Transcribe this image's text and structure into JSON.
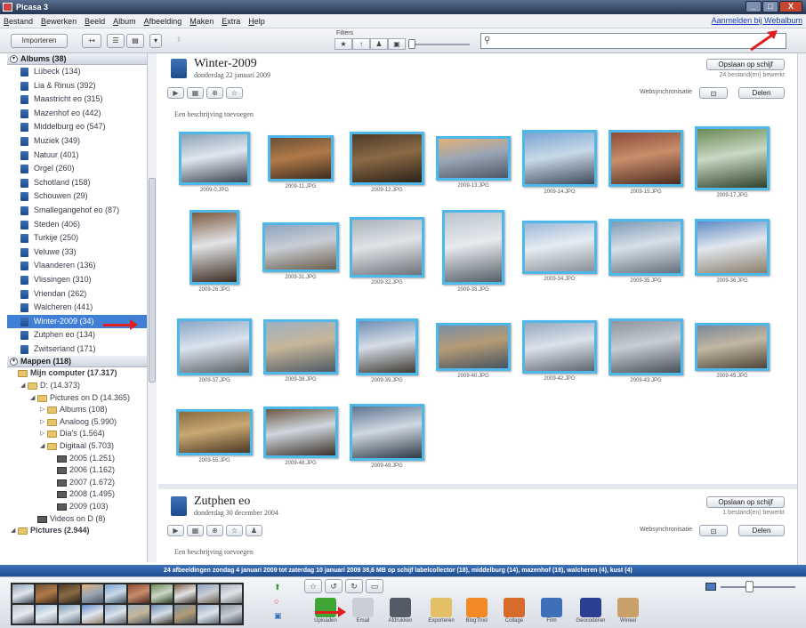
{
  "window": {
    "title": "Picasa 3",
    "min": "_",
    "max": "□",
    "close": "X"
  },
  "menu": {
    "items": [
      "Bestand",
      "Bewerken",
      "Beeld",
      "Album",
      "Afbeelding",
      "Maken",
      "Extra",
      "Help"
    ],
    "login": "Aanmelden bij Webalbum"
  },
  "toolbar": {
    "import": "Importeren",
    "filters_label": "Filters",
    "filter_icons": [
      "★",
      "↑",
      "♟",
      "▣"
    ],
    "search_placeholder": ""
  },
  "sidebar": {
    "albums_header": "Albums (38)",
    "albums": [
      "Lübeck (134)",
      "Lia & Rinus (392)",
      "Maastricht eo (315)",
      "Mazenhof eo (442)",
      "Middelburg eo (547)",
      "Muziek (349)",
      "Natuur (401)",
      "Orgel (260)",
      "Schotland (158)",
      "Schouwen (29)",
      "Smallegangehof eo (87)",
      "Steden (406)",
      "Turkije (250)",
      "Veluwe (33)",
      "Vlaanderen (136)",
      "Vlissingen (310)",
      "Vriendan (262)",
      "Walcheren (441)",
      "Winter-2009 (34)",
      "Zutphen eo (134)",
      "Zwitserland (171)"
    ],
    "selected_album": "Winter-2009 (34)",
    "folders_header": "Mappen (118)",
    "folders": [
      {
        "label": "Mijn computer (17.317)",
        "level": 0,
        "type": "folder",
        "arrow": ""
      },
      {
        "label": "D: (14.373)",
        "level": 1,
        "type": "folder",
        "arrow": "◢"
      },
      {
        "label": "Pictures on D (14.365)",
        "level": 2,
        "type": "folder",
        "arrow": "◢"
      },
      {
        "label": "Albums (108)",
        "level": 3,
        "type": "folder",
        "arrow": "▷"
      },
      {
        "label": "Analoog (5.990)",
        "level": 3,
        "type": "folder",
        "arrow": "▷"
      },
      {
        "label": "Dia's (1.564)",
        "level": 3,
        "type": "folder",
        "arrow": "▷"
      },
      {
        "label": "Digitaal (5.703)",
        "level": 3,
        "type": "folder",
        "arrow": "◢"
      },
      {
        "label": "2005 (1.251)",
        "level": 4,
        "type": "year",
        "arrow": ""
      },
      {
        "label": "2006 (1.162)",
        "level": 4,
        "type": "year",
        "arrow": ""
      },
      {
        "label": "2007 (1.672)",
        "level": 4,
        "type": "year",
        "arrow": ""
      },
      {
        "label": "2008 (1.495)",
        "level": 4,
        "type": "year",
        "arrow": ""
      },
      {
        "label": "2009 (103)",
        "level": 4,
        "type": "year",
        "arrow": ""
      },
      {
        "label": "Videos on D (8)",
        "level": 2,
        "type": "year",
        "arrow": ""
      },
      {
        "label": "Pictures (2.944)",
        "level": 0,
        "type": "folder",
        "arrow": "◢"
      }
    ]
  },
  "album1": {
    "name": "Winter-2009",
    "date": "donderdag 22 januari 2009",
    "save": "Opslaan op schijf",
    "count": "24 bestand(en) bewerkt",
    "buttons": [
      "▶",
      "▦",
      "⊕",
      "☆"
    ],
    "sync_label": "Websynchronisatie",
    "delete": "Delen",
    "desc": "Een beschrijving toevoegen",
    "photos": [
      {
        "cap": "2009-0.JPG",
        "colors": [
          "#8ea3b6",
          "#dfe6ee",
          "#3b4552"
        ]
      },
      {
        "cap": "2009-11.JPG",
        "colors": [
          "#6b5036",
          "#b07a48",
          "#3e2c1f"
        ]
      },
      {
        "cap": "2009-12.JPG",
        "colors": [
          "#4a3a28",
          "#8b6a45",
          "#2a2219"
        ]
      },
      {
        "cap": "2009-13.JPG",
        "colors": [
          "#e2b07a",
          "#9aa6b5",
          "#4d5866"
        ]
      },
      {
        "cap": "2009-14.JPG",
        "colors": [
          "#7aa4d1",
          "#c8d9e8",
          "#3d4a5a"
        ]
      },
      {
        "cap": "2009-15.JPG",
        "colors": [
          "#8a4b35",
          "#c98e6b",
          "#4c2a1f"
        ]
      },
      {
        "cap": "2009-17.JPG",
        "colors": [
          "#6a8a55",
          "#c9d8c4",
          "#2f3f28"
        ]
      },
      {
        "cap": "2009-26.JPG",
        "colors": [
          "#7d5a40",
          "#e2e4e6",
          "#3d2d22"
        ]
      },
      {
        "cap": "2009-31.JPG",
        "colors": [
          "#8ea4be",
          "#c9ced5",
          "#6b5d4c"
        ]
      },
      {
        "cap": "2009-32.JPG",
        "colors": [
          "#aab3bc",
          "#dfe3e7",
          "#6d737a"
        ]
      },
      {
        "cap": "2009-33.JPG",
        "colors": [
          "#b9c3cc",
          "#e7eaee",
          "#555e68"
        ]
      },
      {
        "cap": "2009-34.JPG",
        "colors": [
          "#9db7d4",
          "#e5ecf2",
          "#8a9097"
        ]
      },
      {
        "cap": "2009-35.JPG",
        "colors": [
          "#7d9ab5",
          "#d7e0e8",
          "#64707c"
        ]
      },
      {
        "cap": "2009-36.JPG",
        "colors": [
          "#5f8ac4",
          "#e1e7ee",
          "#8a7e6a"
        ]
      },
      {
        "cap": "2009-37.JPG",
        "colors": [
          "#8ba6c6",
          "#d9e3ec",
          "#5a5f66"
        ]
      },
      {
        "cap": "2009-38.JPG",
        "colors": [
          "#9eb0c2",
          "#c6b69a",
          "#4f5a64"
        ]
      },
      {
        "cap": "2009-39.JPG",
        "colors": [
          "#6f8fb4",
          "#d5dde6",
          "#3f3a33"
        ]
      },
      {
        "cap": "2009-40.JPG",
        "colors": [
          "#7a8ea3",
          "#b59b76",
          "#465360"
        ]
      },
      {
        "cap": "2009-42.JPG",
        "colors": [
          "#95a9bf",
          "#dbe2ea",
          "#5d6670"
        ]
      },
      {
        "cap": "2009-43.JPG",
        "colors": [
          "#8c949d",
          "#c7cdd3",
          "#4a5058"
        ]
      },
      {
        "cap": "2009-45.JPG",
        "colors": [
          "#7b8796",
          "#c2b7a2",
          "#4d4438"
        ]
      },
      {
        "cap": "2009-55.JPG",
        "colors": [
          "#8b6a42",
          "#c9a873",
          "#4a3823"
        ]
      },
      {
        "cap": "2009-48.JPG",
        "colors": [
          "#6b5844",
          "#cfd6dd",
          "#3a3128"
        ]
      },
      {
        "cap": "2009-49.JPG",
        "colors": [
          "#5e7590",
          "#d0d9e2",
          "#2e3845"
        ]
      }
    ]
  },
  "album2": {
    "name": "Zutphen eo",
    "date": "donderdag 30 december 2004",
    "save": "Opslaan op schijf",
    "count": "1 bestand(en) bewerkt",
    "buttons": [
      "▶",
      "▦",
      "⊕",
      "☆",
      "♟"
    ],
    "sync_label": "Websynchronisatie",
    "delete": "Delen",
    "desc": "Een beschrijving toevoegen"
  },
  "infobar": "24 afbeeldingen   zondag 4 januari 2009   tot zaterdag 10 januari 2009   38,6 MB op schijf   labelcollector (18), middelburg (14), mazenhof (18), walcheren (4), kust (4)",
  "tray": {
    "top_buttons": [
      "☆",
      "↺",
      "↻",
      "▭"
    ],
    "actions": [
      "Uploaden",
      "Email",
      "Afdrukken",
      "Exporteren",
      "BlogThis!",
      "Collage",
      "Film",
      "Geocoderen",
      "Winkel"
    ],
    "action_colors": [
      "#3fa535",
      "#c9ced6",
      "#555b66",
      "#e3c067",
      "#f08a24",
      "#d66a2a",
      "#3f6fb8",
      "#2a3f8f",
      "#c9a06a"
    ]
  },
  "accent": "#4fb8ea",
  "selection": "#3f7fd6"
}
